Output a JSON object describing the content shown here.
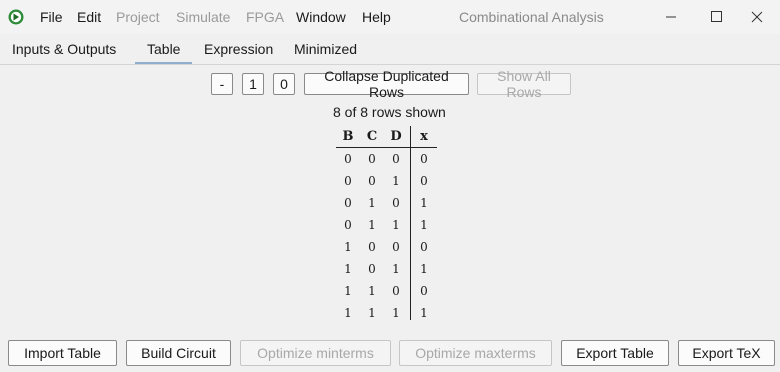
{
  "window": {
    "title": "Combinational Analysis",
    "menu": [
      "File",
      "Edit",
      "Project",
      "Simulate",
      "FPGA",
      "Window",
      "Help"
    ],
    "menu_disabled": [
      "Project",
      "Simulate",
      "FPGA"
    ]
  },
  "tabs": [
    {
      "label": "Inputs & Outputs",
      "selected": false
    },
    {
      "label": "Table",
      "selected": true
    },
    {
      "label": "Expression",
      "selected": false
    },
    {
      "label": "Minimized",
      "selected": false
    }
  ],
  "toolbar": {
    "dash_label": "-",
    "one_label": "1",
    "zero_label": "0",
    "collapse_label": "Collapse Duplicated Rows",
    "show_all_label": "Show All Rows"
  },
  "rows_shown": "8 of 8 rows shown",
  "truth_table": {
    "inputs": [
      "B",
      "C",
      "D"
    ],
    "outputs": [
      "x"
    ],
    "rows": [
      [
        "0",
        "0",
        "0",
        "0"
      ],
      [
        "0",
        "0",
        "1",
        "0"
      ],
      [
        "0",
        "1",
        "0",
        "1"
      ],
      [
        "0",
        "1",
        "1",
        "1"
      ],
      [
        "1",
        "0",
        "0",
        "0"
      ],
      [
        "1",
        "0",
        "1",
        "1"
      ],
      [
        "1",
        "1",
        "0",
        "0"
      ],
      [
        "1",
        "1",
        "1",
        "1"
      ]
    ]
  },
  "bottom_buttons": {
    "import_table": "Import Table",
    "build_circuit": "Build Circuit",
    "optimize_minterms": "Optimize minterms",
    "optimize_maxterms": "Optimize maxterms",
    "export_table": "Export Table",
    "export_tex": "Export TeX"
  },
  "colors": {
    "app_icon": "#2e8b3a",
    "tab_underline": "#8faecb",
    "disabled_text": "#9a9a9a"
  }
}
